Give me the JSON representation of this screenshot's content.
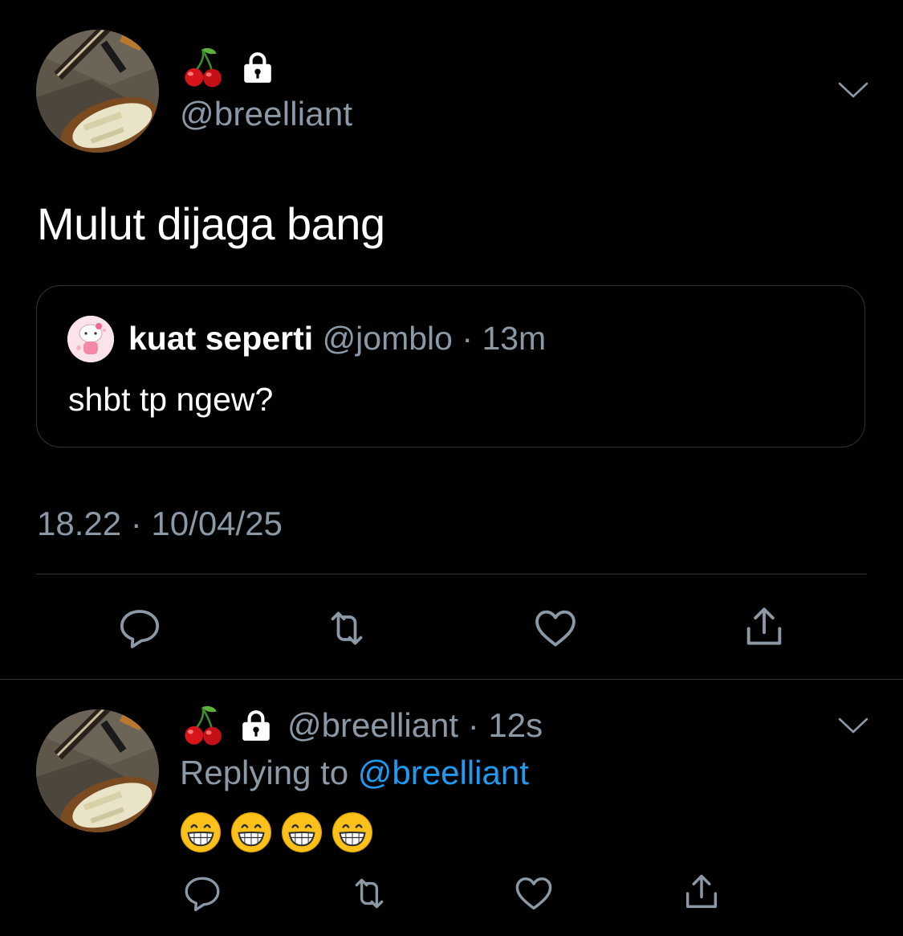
{
  "main_tweet": {
    "display_name_icons": [
      "cherry-emoji",
      "lock-icon"
    ],
    "handle": "@breelliant",
    "text": "Mulut dijaga bang",
    "quoted": {
      "name": "kuat seperti",
      "handle": "@jomblo",
      "separator": "·",
      "time": "13m",
      "text": "shbt tp ngew?"
    },
    "timestamp": "18.22 · 10/04/25",
    "actions": [
      "reply-icon",
      "retweet-icon",
      "like-icon",
      "share-icon"
    ]
  },
  "reply_tweet": {
    "display_name_icons": [
      "cherry-emoji",
      "lock-icon"
    ],
    "handle": "@breelliant",
    "separator": "·",
    "time": "12s",
    "replying_to_label": "Replying to",
    "replying_to_handle": "@breelliant",
    "emojis": [
      "grinning-face-emoji",
      "grinning-face-emoji",
      "grinning-face-emoji",
      "grinning-face-emoji"
    ],
    "actions": [
      "reply-icon",
      "retweet-icon",
      "like-icon",
      "share-icon"
    ]
  },
  "colors": {
    "background": "#000000",
    "text_primary": "#ffffff",
    "text_secondary": "#8b98a5",
    "link": "#1d9bf0",
    "border": "#2f3336"
  }
}
